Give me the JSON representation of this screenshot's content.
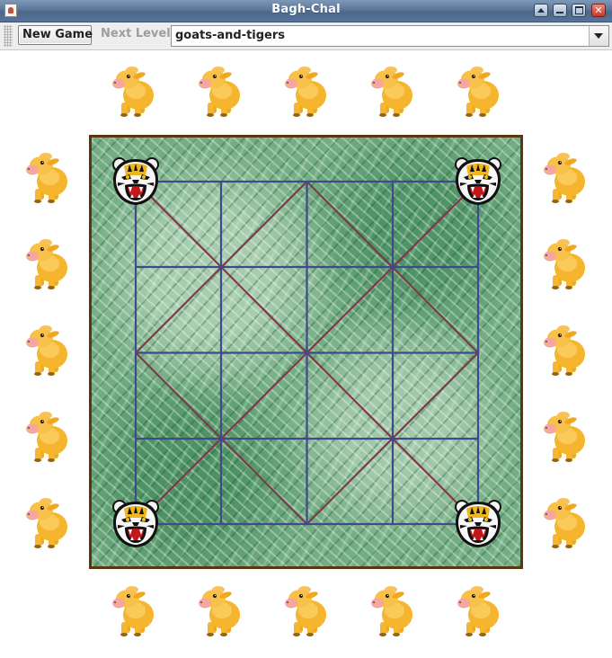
{
  "window": {
    "title": "Bagh-Chal"
  },
  "toolbar": {
    "new_game_label": "New Game",
    "next_level_label": "Next Level",
    "level_selected": "goats-and-tigers"
  },
  "game": {
    "board_size": "5x5",
    "tigers_on_board": 4,
    "goats_waiting": 20,
    "colors": {
      "grid_line": "#3f4a8a",
      "diagonal_line": "#7a3a4a",
      "board_border": "#5a3613",
      "board_green": "#73ad83",
      "goat_body": "#f6b52e"
    }
  }
}
